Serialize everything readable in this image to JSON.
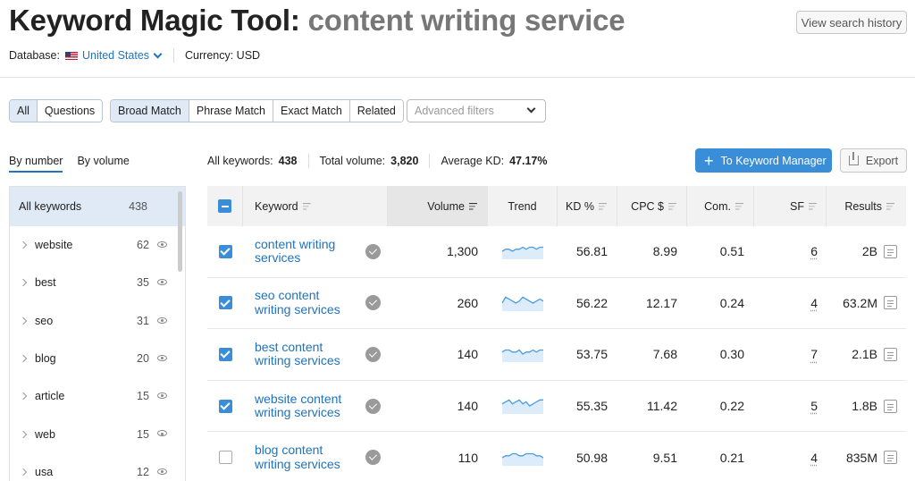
{
  "header": {
    "title_prefix": "Keyword Magic Tool:",
    "query": "content writing service",
    "history_button": "View search history",
    "database_label": "Database:",
    "database_value": "United States",
    "currency": "Currency: USD"
  },
  "filters": {
    "question_tabs": [
      "All",
      "Questions"
    ],
    "match_tabs": [
      "Broad Match",
      "Phrase Match",
      "Exact Match",
      "Related"
    ],
    "advanced_placeholder": "Advanced filters"
  },
  "sort_tabs": [
    "By number",
    "By volume"
  ],
  "sidebar": {
    "all_label": "All keywords",
    "all_count": "438",
    "items": [
      {
        "label": "website",
        "count": "62"
      },
      {
        "label": "best",
        "count": "35"
      },
      {
        "label": "seo",
        "count": "31"
      },
      {
        "label": "blog",
        "count": "20"
      },
      {
        "label": "article",
        "count": "15"
      },
      {
        "label": "web",
        "count": "15"
      },
      {
        "label": "usa",
        "count": "12"
      }
    ]
  },
  "stats": {
    "all_keywords_label": "All keywords:",
    "all_keywords_value": "438",
    "total_volume_label": "Total volume:",
    "total_volume_value": "3,820",
    "avg_kd_label": "Average KD:",
    "avg_kd_value": "47.17%"
  },
  "actions": {
    "keyword_manager": "To Keyword Manager",
    "export": "Export"
  },
  "columns": [
    "Keyword",
    "Volume",
    "Trend",
    "KD %",
    "CPC $",
    "Com.",
    "SF",
    "Results"
  ],
  "rows": [
    {
      "kw1": "content writing",
      "kw2": "services",
      "volume": "1,300",
      "kd": "56.81",
      "cpc": "8.99",
      "com": "0.51",
      "sf": "6",
      "results": "2B",
      "checked": true,
      "trend": [
        4,
        5,
        5,
        4,
        5,
        5,
        6,
        5,
        6,
        6,
        5,
        6,
        6
      ]
    },
    {
      "kw1": "seo content",
      "kw2": "writing services",
      "volume": "260",
      "kd": "56.22",
      "cpc": "12.17",
      "com": "0.24",
      "sf": "4",
      "results": "63.2M",
      "checked": true,
      "trend": [
        4,
        7,
        6,
        5,
        4,
        5,
        7,
        6,
        5,
        4,
        5,
        6,
        5
      ]
    },
    {
      "kw1": "best content",
      "kw2": "writing services",
      "volume": "140",
      "kd": "53.75",
      "cpc": "7.68",
      "com": "0.30",
      "sf": "7",
      "results": "2.1B",
      "checked": true,
      "trend": [
        5,
        6,
        6,
        5,
        5,
        6,
        4,
        5,
        5,
        6,
        5,
        6,
        6
      ]
    },
    {
      "kw1": "website content",
      "kw2": "writing services",
      "volume": "140",
      "kd": "55.35",
      "cpc": "11.42",
      "com": "0.22",
      "sf": "5",
      "results": "1.8B",
      "checked": true,
      "trend": [
        5,
        6,
        7,
        5,
        6,
        7,
        5,
        6,
        4,
        5,
        6,
        7,
        7
      ]
    },
    {
      "kw1": "blog content",
      "kw2": "writing services",
      "volume": "110",
      "kd": "50.98",
      "cpc": "9.51",
      "com": "0.21",
      "sf": "4",
      "results": "835M",
      "checked": false,
      "trend": [
        4,
        5,
        5,
        6,
        6,
        5,
        5,
        6,
        6,
        6,
        5,
        5,
        4
      ]
    }
  ],
  "colors": {
    "accent": "#3a8ed8",
    "link": "#1e73be",
    "trend": "#4a9de0"
  }
}
